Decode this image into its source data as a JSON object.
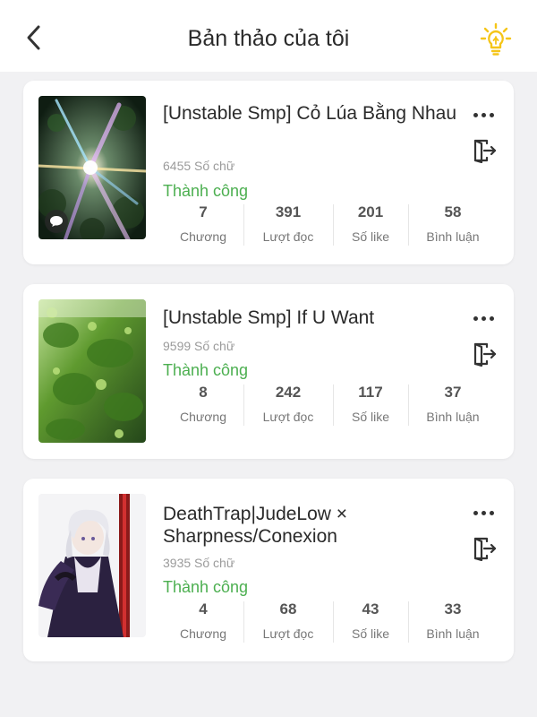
{
  "header": {
    "title": "Bản thảo của tôi",
    "back_icon": "chevron-left-icon",
    "hint_icon": "lightbulb-icon",
    "hint_icon_color": "#f5c518"
  },
  "colors": {
    "background": "#f1f1f3",
    "status_success": "#4caf50"
  },
  "stat_labels": {
    "chapters": "Chương",
    "reads": "Lượt đọc",
    "likes": "Số like",
    "comments": "Bình luận"
  },
  "stories": [
    {
      "title": "[Unstable Smp] Cỏ Lúa Bằng Nhau",
      "word_count": "6455 Số chữ",
      "status": "Thành công",
      "chapters": "7",
      "reads": "391",
      "likes": "201",
      "comments": "58",
      "cover": "sunlight-through-forest-canopy"
    },
    {
      "title": "[Unstable Smp] If U Want",
      "word_count": "9599 Số chữ",
      "status": "Thành công",
      "chapters": "8",
      "reads": "242",
      "likes": "117",
      "comments": "37",
      "cover": "sunlit-green-leaves"
    },
    {
      "title": "DeathTrap|JudeLow × Sharpness/Conexion",
      "word_count": "3935 Số chữ",
      "status": "Thành công",
      "chapters": "4",
      "reads": "68",
      "likes": "43",
      "comments": "33",
      "cover": "anime-character-illustration"
    }
  ]
}
